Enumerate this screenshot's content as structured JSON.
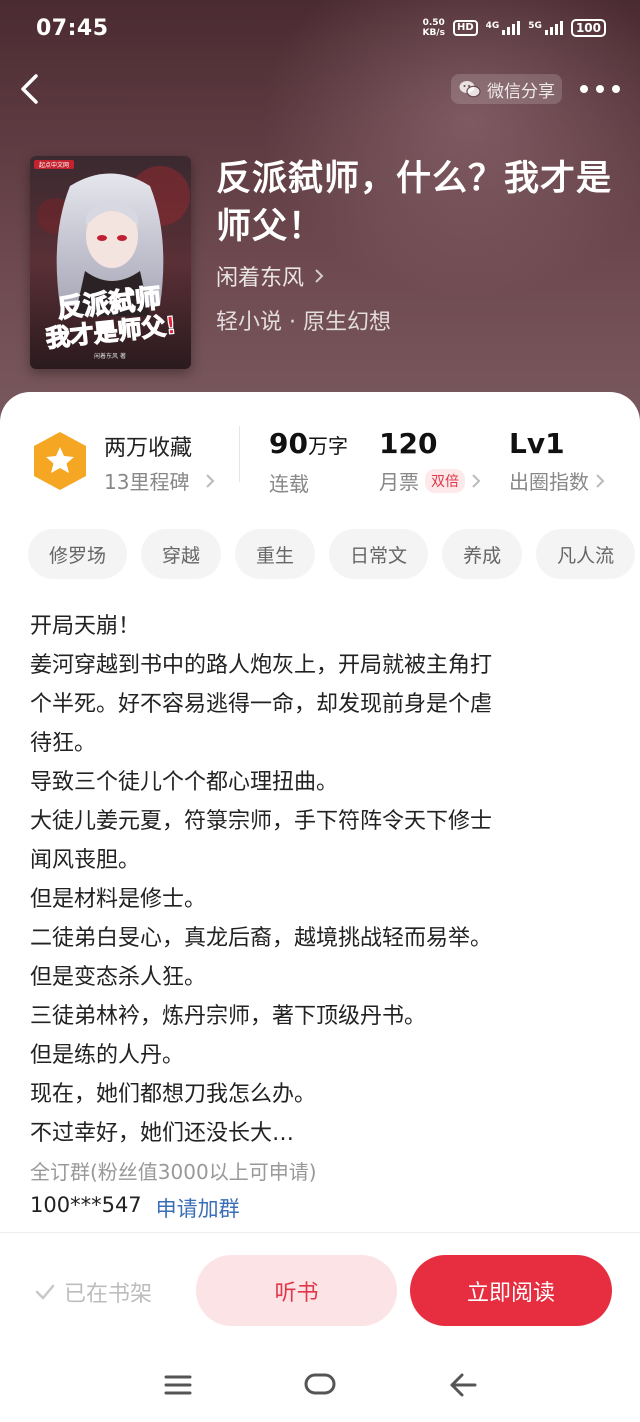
{
  "status": {
    "time": "07:45",
    "net_speed_value": "0.50",
    "net_speed_unit": "KB/s",
    "hd_label": "HD",
    "sim1_label": "4G",
    "sim2_label": "5G",
    "battery": "100"
  },
  "header": {
    "share_label": "微信分享"
  },
  "book": {
    "cover_title_line1": "反派弑师",
    "cover_title_line2": "我才是师父!",
    "cover_publisher": "起点中文网",
    "cover_author": "闲着东风 著",
    "title": "反派弑师，什么？我才是师父！",
    "author": "闲着东风",
    "genre": "轻小说 · 原生幻想"
  },
  "stats": {
    "favorites": "两万收藏",
    "milestones": "13里程碑",
    "words_number": "90",
    "words_unit": "万字",
    "words_status": "连载",
    "monthly_tickets": "120",
    "monthly_label": "月票",
    "double_badge": "双倍",
    "level": "Lv1",
    "level_label": "出圈指数"
  },
  "tags": [
    "修罗场",
    "穿越",
    "重生",
    "日常文",
    "养成",
    "凡人流"
  ],
  "description": [
    "开局天崩！",
    "姜河穿越到书中的路人炮灰上，开局就被主角打",
    "个半死。好不容易逃得一命，却发现前身是个虐",
    "待狂。",
    "导致三个徒儿个个都心理扭曲。",
    "大徒儿姜元夏，符箓宗师，手下符阵令天下修士",
    "闻风丧胆。",
    "但是材料是修士。",
    "二徒弟白旻心，真龙后裔，越境挑战轻而易举。",
    "但是变态杀人狂。",
    "三徒弟林衿，炼丹宗师，著下顶级丹书。",
    "但是练的人丹。",
    "现在，她们都想刀我怎么办。",
    "不过幸好，她们还没长大…"
  ],
  "group": {
    "label": "全订群(粉丝值3000以上可申请)",
    "id": "100***547",
    "join_label": "申请加群"
  },
  "actions": {
    "shelf_label": "已在书架",
    "listen_label": "听书",
    "read_label": "立即阅读"
  },
  "colors": {
    "accent": "#e62e40",
    "link": "#3a6fb8",
    "badge": "#f5a623"
  }
}
